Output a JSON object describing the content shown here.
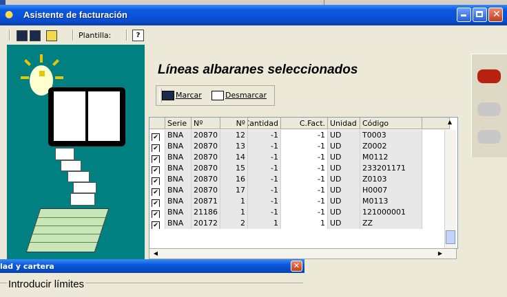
{
  "window": {
    "title": "Asistente de facturación"
  },
  "toolbar": {
    "template_label": "Plantilla:",
    "help_glyph": "?"
  },
  "main": {
    "heading": "Líneas albaranes seleccionados",
    "mark_label": "Marcar",
    "unmark_label": "Desmarcar"
  },
  "grid": {
    "columns": [
      "",
      "Serie",
      "Nº",
      "Nº",
      "Cantidad",
      "C.Fact.",
      "Unidad",
      "Código"
    ],
    "rows": [
      {
        "checked": true,
        "serie": "BNA",
        "num": "20870",
        "linea": "12",
        "cantidad": "-1",
        "cfact": "-1",
        "unidad": "UD",
        "codigo": "T0003"
      },
      {
        "checked": true,
        "serie": "BNA",
        "num": "20870",
        "linea": "13",
        "cantidad": "-1",
        "cfact": "-1",
        "unidad": "UD",
        "codigo": "Z0002"
      },
      {
        "checked": true,
        "serie": "BNA",
        "num": "20870",
        "linea": "14",
        "cantidad": "-1",
        "cfact": "-1",
        "unidad": "UD",
        "codigo": "M0112"
      },
      {
        "checked": true,
        "serie": "BNA",
        "num": "20870",
        "linea": "15",
        "cantidad": "-1",
        "cfact": "-1",
        "unidad": "UD",
        "codigo": "233201171"
      },
      {
        "checked": true,
        "serie": "BNA",
        "num": "20870",
        "linea": "16",
        "cantidad": "-1",
        "cfact": "-1",
        "unidad": "UD",
        "codigo": "Z0103"
      },
      {
        "checked": true,
        "serie": "BNA",
        "num": "20870",
        "linea": "17",
        "cantidad": "-1",
        "cfact": "-1",
        "unidad": "UD",
        "codigo": "H0007"
      },
      {
        "checked": true,
        "serie": "BNA",
        "num": "20871",
        "linea": "1",
        "cantidad": "-1",
        "cfact": "-1",
        "unidad": "UD",
        "codigo": "M0113"
      },
      {
        "checked": true,
        "serie": "BNA",
        "num": "21186",
        "linea": "1",
        "cantidad": "-1",
        "cfact": "-1",
        "unidad": "UD",
        "codigo": "121000001"
      },
      {
        "checked": true,
        "serie": "BNA",
        "num": "20172",
        "linea": "2",
        "cantidad": "1",
        "cfact": "1",
        "unidad": "UD",
        "codigo": "ZZ"
      }
    ]
  },
  "dialog": {
    "title": "lad y cartera",
    "group_label": "Introducir límites"
  },
  "colors": {
    "titlebar": "#0a5ae0",
    "illustration_bg": "#008080",
    "window_bg": "#ece9d8"
  }
}
